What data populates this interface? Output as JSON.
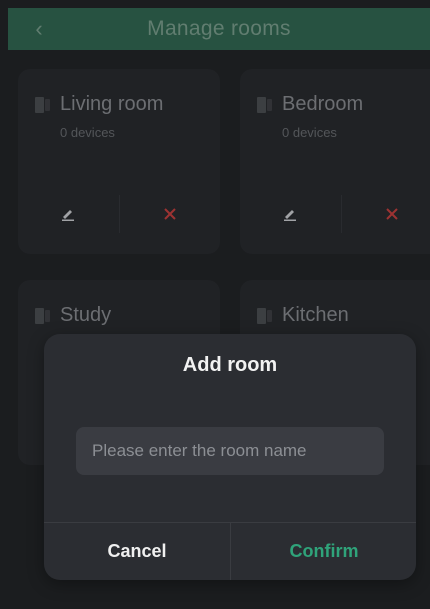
{
  "header": {
    "title": "Manage rooms",
    "back_icon": "chevron-left-icon",
    "bg_color": "#2d5e4a"
  },
  "rooms": [
    {
      "name": "Living room",
      "count": "0 devices",
      "edit_icon": "pencil-icon",
      "delete_icon": "close-icon"
    },
    {
      "name": "Bedroom",
      "count": "0 devices",
      "edit_icon": "pencil-icon",
      "delete_icon": "close-icon"
    },
    {
      "name": "Study"
    },
    {
      "name": "Kitchen"
    }
  ],
  "dialog": {
    "title": "Add room",
    "input_placeholder": "Please enter the room name",
    "input_value": "",
    "cancel_label": "Cancel",
    "confirm_label": "Confirm",
    "confirm_color": "#2fa37a"
  },
  "colors": {
    "delete": "#b23a3a",
    "background": "#1f2124"
  }
}
